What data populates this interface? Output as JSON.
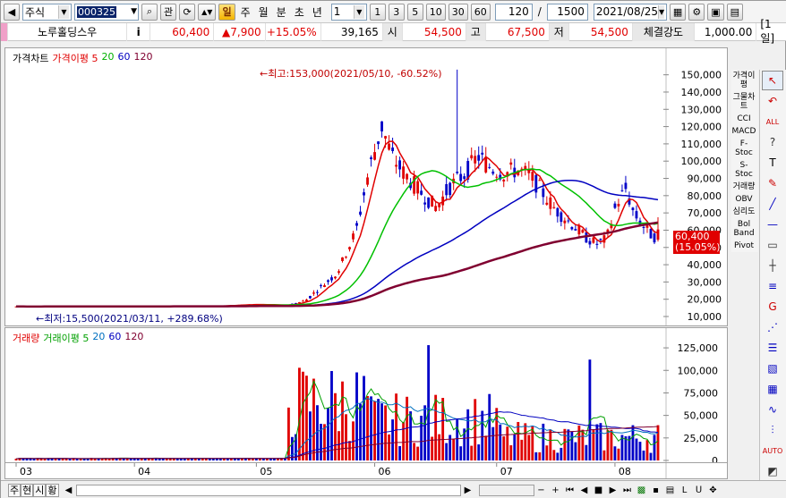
{
  "toolbar": {
    "market": "주식",
    "code": "000325",
    "btn_search": "⌕",
    "btn_watch": "관",
    "periods": [
      "일",
      "주",
      "월",
      "분",
      "초",
      "년"
    ],
    "period_count": "1",
    "quick_counts": [
      "1",
      "3",
      "5",
      "10",
      "30",
      "60"
    ],
    "display_count": "120",
    "slash": "/",
    "total_count": "1500",
    "date": "2021/08/25"
  },
  "infobar": {
    "stock_name": "노루홀딩스우",
    "info_icon": "i",
    "price": "60,400",
    "change": "▲7,900",
    "change_rate": "+15.05%",
    "volume": "39,165",
    "open_label": "시",
    "open": "54,500",
    "high_label": "고",
    "high": "67,500",
    "low_label": "저",
    "low": "54,500",
    "strength_label": "체결강도",
    "strength": "1,000.00",
    "period_tag": "[1일]"
  },
  "price_pane": {
    "legend": [
      "가격차트",
      "가격이평 5",
      "20",
      "60",
      "120"
    ],
    "legend_colors": [
      "#000000",
      "#e00000",
      "#00c000",
      "#0000c0",
      "#800000"
    ],
    "max_note": "←최고:153,000(2021/05/10, -60.52%)",
    "min_note": "←최저:15,500(2021/03/11, +289.68%)",
    "y_ticks": [
      "150,000",
      "140,000",
      "130,000",
      "120,000",
      "110,000",
      "100,000",
      "90,000",
      "80,000",
      "70,000",
      "60,000",
      "50,000",
      "40,000",
      "30,000",
      "20,000",
      "10,000"
    ],
    "last_price_tag": "60,400",
    "last_rate_tag": "(15.05%)"
  },
  "volume_pane": {
    "legend": [
      "거래량",
      "거래이평 5",
      "20",
      "60",
      "120"
    ],
    "legend_colors": [
      "#e00000",
      "#00a000",
      "#0070c0",
      "#0000c0",
      "#800000"
    ],
    "y_ticks": [
      "125,000",
      "100,000",
      "75,000",
      "50,000",
      "25,000",
      "0"
    ]
  },
  "x_axis": [
    "03",
    "04",
    "05",
    "06",
    "07",
    "08"
  ],
  "indicator_menu": [
    "가격이평",
    "그물차트",
    "CCI",
    "MACD",
    "F-Stoc",
    "S-Stoc",
    "거래량",
    "OBV",
    "심리도",
    "Bol Band",
    "Pivot"
  ],
  "bottom": {
    "tabs": [
      "주",
      "현",
      "시",
      "황"
    ]
  },
  "colors": {
    "up": "#e00000",
    "down": "#0000c8",
    "ma5": "#e00000",
    "ma20": "#00c000",
    "ma60": "#0000c0",
    "ma120": "#800030"
  },
  "chart_data": {
    "type": "candlestick",
    "x": [
      "03",
      "04",
      "05",
      "06",
      "07",
      "08"
    ],
    "y_range": [
      10000,
      155000
    ],
    "series": [
      {
        "name": "가격차트",
        "summary": {
          "last_open": 54500,
          "last_high": 67500,
          "last_low": 54500,
          "last_close": 60400,
          "max": 153000,
          "min": 15500
        }
      },
      {
        "name": "가격이평 5"
      },
      {
        "name": "20"
      },
      {
        "name": "60"
      },
      {
        "name": "120"
      }
    ],
    "volume_range": [
      0,
      135000
    ]
  }
}
